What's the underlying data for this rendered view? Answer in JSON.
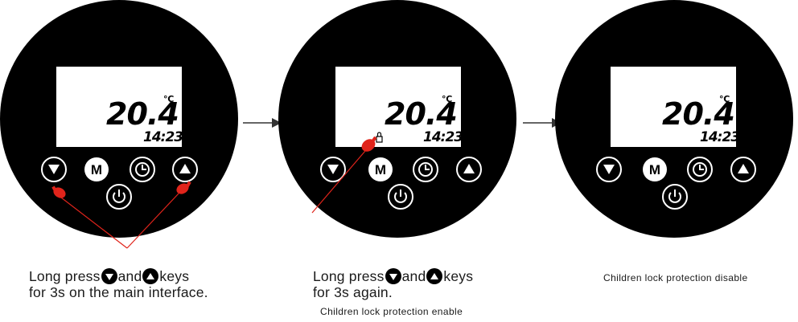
{
  "panels": [
    {
      "display": {
        "temperature": "20.4",
        "unit": "℃",
        "time": "14:23"
      },
      "keys": {
        "mode": "M"
      },
      "lock_icon_visible": false
    },
    {
      "display": {
        "temperature": "20.4",
        "unit": "℃",
        "time": "14:23"
      },
      "keys": {
        "mode": "M"
      },
      "lock_icon_visible": true
    },
    {
      "display": {
        "temperature": "20.4",
        "unit": "℃",
        "time": "14:23"
      },
      "keys": {
        "mode": "M"
      },
      "lock_icon_visible": false
    }
  ],
  "captions": {
    "step1": {
      "prefix": "Long press",
      "middle": "and",
      "suffix": "keys",
      "line2": "for 3s on the main interface."
    },
    "step2": {
      "prefix": "Long press",
      "middle": "and",
      "suffix": "keys",
      "line2": "for 3s again.",
      "note": "Children lock protection enable"
    },
    "step3": {
      "note": "Children lock protection disable"
    }
  },
  "colors": {
    "device": "#000000",
    "screen": "#ffffff",
    "arrow": "#333333",
    "pointer": "#e0241b"
  },
  "icons": [
    "down-triangle-icon",
    "mode-key-icon",
    "clock-icon",
    "up-triangle-icon",
    "power-icon",
    "lock-icon",
    "finger-press-icon",
    "right-arrow-icon"
  ]
}
